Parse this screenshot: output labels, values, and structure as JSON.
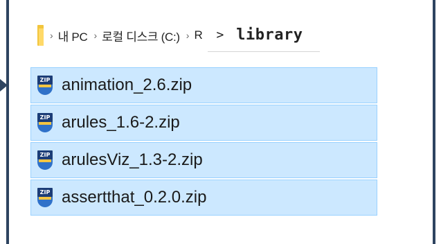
{
  "breadcrumb": {
    "separator": "›",
    "items": [
      "내 PC",
      "로컬 디스크 (C:)",
      "R"
    ],
    "input_arrow": ">",
    "current": "library"
  },
  "files": [
    {
      "name": "animation_2.6.zip",
      "icon": "zip-archive-icon",
      "badge": "ZIP"
    },
    {
      "name": "arules_1.6-2.zip",
      "icon": "zip-archive-icon",
      "badge": "ZIP"
    },
    {
      "name": "arulesViz_1.3-2.zip",
      "icon": "zip-archive-icon",
      "badge": "ZIP"
    },
    {
      "name": "assertthat_0.2.0.zip",
      "icon": "zip-archive-icon",
      "badge": "ZIP"
    }
  ],
  "colors": {
    "frame": "#2e4460",
    "selection_bg": "#cce8ff",
    "selection_border": "#99d1ff",
    "folder": "#f2c53d"
  }
}
